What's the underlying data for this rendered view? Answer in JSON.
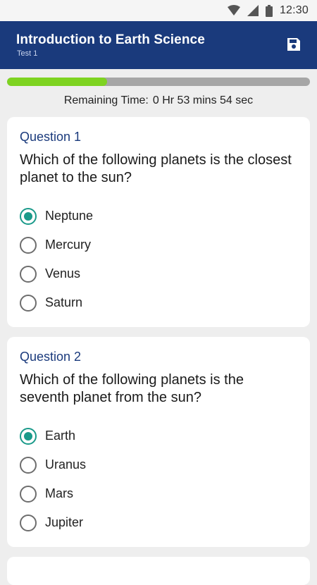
{
  "status_bar": {
    "time": "12:30"
  },
  "header": {
    "title": "Introduction to Earth Science",
    "subtitle": "Test 1",
    "save_icon": "save-icon"
  },
  "progress": {
    "fraction": 0.33
  },
  "timer": {
    "label": "Remaining Time:",
    "value": "0 Hr 53 mins 54 sec"
  },
  "questions": [
    {
      "label": "Question 1",
      "text": "Which of the following planets is the closest planet to the sun?",
      "options": [
        {
          "label": "Neptune",
          "selected": true
        },
        {
          "label": "Mercury",
          "selected": false
        },
        {
          "label": "Venus",
          "selected": false
        },
        {
          "label": "Saturn",
          "selected": false
        }
      ]
    },
    {
      "label": "Question 2",
      "text": "Which of the following planets is the seventh planet from the sun?",
      "options": [
        {
          "label": "Earth",
          "selected": true
        },
        {
          "label": "Uranus",
          "selected": false
        },
        {
          "label": "Mars",
          "selected": false
        },
        {
          "label": "Jupiter",
          "selected": false
        }
      ]
    }
  ],
  "colors": {
    "app_bar": "#1a3a7c",
    "progress_fill": "#7ed321",
    "progress_track": "#a6a6a6",
    "radio_selected": "#1a9a8a"
  }
}
